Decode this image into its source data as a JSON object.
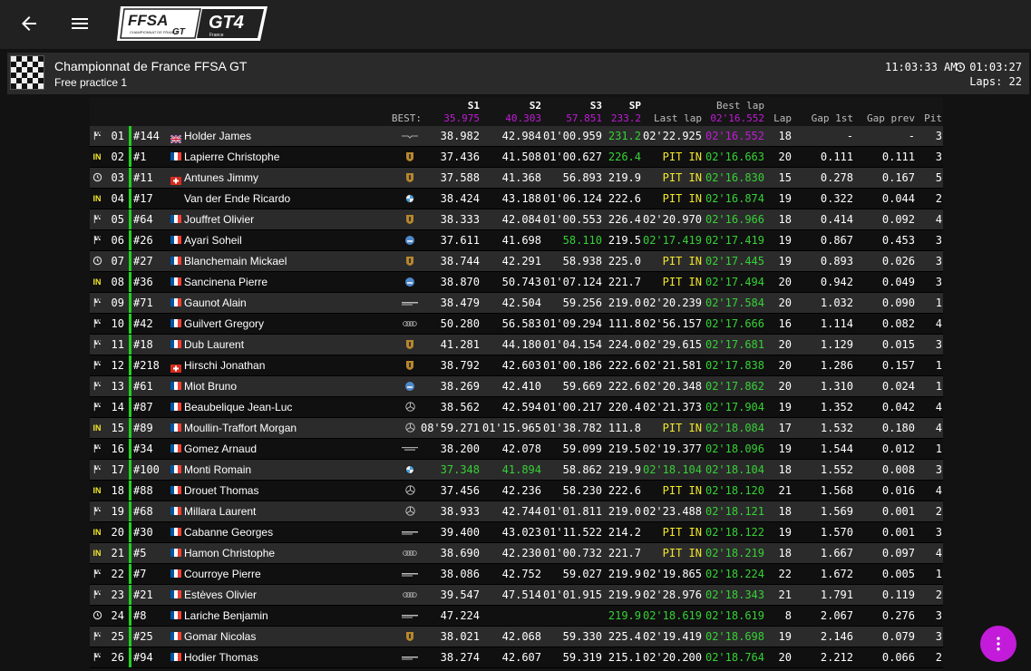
{
  "header": {
    "logo_ffsa": "FFSA",
    "logo_sub": "CHAMPIONNAT DE FRANCE",
    "logo_gt": "GT",
    "logo_gt4": "GT4",
    "logo_country": "France"
  },
  "session": {
    "championship": "Championnat de France FFSA GT",
    "name": "Free practice 1",
    "clock": "11:03:33 AM",
    "elapsed": "01:03:27",
    "laps": "Laps: 22"
  },
  "columns": {
    "best_label": "BEST:",
    "s1": "S1",
    "s1_best": "35.975",
    "s2": "S2",
    "s2_best": "40.303",
    "s3": "S3",
    "s3_best": "57.851",
    "sp": "SP",
    "sp_best": "233.2",
    "last_lap": "Last lap",
    "best_lap": "Best lap",
    "best_lap_best": "02'16.552",
    "lap": "Lap",
    "gap1": "Gap 1st",
    "gapp": "Gap prev",
    "pit": "Pit"
  },
  "colors": {
    "purple": "#c21bd9",
    "green": "#36d136",
    "yellow": "#f2e72a"
  },
  "rows": [
    {
      "status": "flag",
      "pos": "01",
      "num": "#144",
      "nat": "gb",
      "name": "Holder James",
      "brand": "aston",
      "s1": "38.982",
      "s2": "42.984",
      "s3": "01'00.959",
      "sp": "231.2",
      "sp_c": "g",
      "last": "02'22.925",
      "last_c": "",
      "best": "02'16.552",
      "best_c": "p",
      "lap": "18",
      "gap1": "-",
      "gapp": "-",
      "pit": "3"
    },
    {
      "status": "IN",
      "pos": "02",
      "num": "#1",
      "nat": "fr",
      "name": "Lapierre Christophe",
      "brand": "porsche",
      "s1": "37.436",
      "s2": "41.508",
      "s3": "01'00.627",
      "sp": "226.4",
      "sp_c": "g",
      "last": "PIT IN",
      "last_c": "y",
      "best": "02'16.663",
      "best_c": "g",
      "lap": "20",
      "gap1": "0.111",
      "gapp": "0.111",
      "pit": "3"
    },
    {
      "status": "clock",
      "pos": "03",
      "num": "#11",
      "nat": "ch",
      "name": "Antunes Jimmy",
      "brand": "porsche",
      "s1": "37.588",
      "s2": "41.368",
      "s3": "56.893",
      "sp": "219.9",
      "sp_c": "",
      "last": "PIT IN",
      "last_c": "y",
      "best": "02'16.830",
      "best_c": "g",
      "lap": "15",
      "gap1": "0.278",
      "gapp": "0.167",
      "pit": "5"
    },
    {
      "status": "IN",
      "pos": "04",
      "num": "#17",
      "nat": "",
      "name": "Van der Ende Ricardo",
      "brand": "bmw",
      "s1": "38.424",
      "s2": "43.188",
      "s3": "01'06.124",
      "sp": "222.6",
      "sp_c": "",
      "last": "PIT IN",
      "last_c": "y",
      "best": "02'16.874",
      "best_c": "g",
      "lap": "19",
      "gap1": "0.322",
      "gapp": "0.044",
      "pit": "2"
    },
    {
      "status": "flag",
      "pos": "05",
      "num": "#64",
      "nat": "fr",
      "name": "Jouffret Olivier",
      "brand": "porsche",
      "s1": "38.333",
      "s2": "42.084",
      "s3": "01'00.553",
      "sp": "226.4",
      "sp_c": "",
      "last": "02'20.970",
      "last_c": "",
      "best": "02'16.966",
      "best_c": "g",
      "lap": "18",
      "gap1": "0.414",
      "gapp": "0.092",
      "pit": "4"
    },
    {
      "status": "flag",
      "pos": "06",
      "num": "#26",
      "nat": "fr",
      "name": "Ayari Soheil",
      "brand": "alpine",
      "s1": "37.611",
      "s2": "41.698",
      "s3": "58.110",
      "s3_c": "g",
      "sp": "219.5",
      "sp_c": "",
      "last": "02'17.419",
      "last_c": "g",
      "best": "02'17.419",
      "best_c": "g",
      "lap": "19",
      "gap1": "0.867",
      "gapp": "0.453",
      "pit": "3"
    },
    {
      "status": "clock",
      "pos": "07",
      "num": "#27",
      "nat": "fr",
      "name": "Blanchemain Mickael",
      "brand": "porsche",
      "s1": "38.744",
      "s2": "42.291",
      "s3": "58.938",
      "sp": "225.0",
      "sp_c": "",
      "last": "PIT IN",
      "last_c": "y",
      "best": "02'17.445",
      "best_c": "g",
      "lap": "19",
      "gap1": "0.893",
      "gapp": "0.026",
      "pit": "3"
    },
    {
      "status": "IN",
      "pos": "08",
      "num": "#36",
      "nat": "fr",
      "name": "Sancinena Pierre",
      "brand": "alpine",
      "s1": "38.870",
      "s2": "50.743",
      "s3": "01'07.124",
      "sp": "221.7",
      "sp_c": "",
      "last": "PIT IN",
      "last_c": "y",
      "best": "02'17.494",
      "best_c": "g",
      "lap": "20",
      "gap1": "0.942",
      "gapp": "0.049",
      "pit": "3"
    },
    {
      "status": "flag",
      "pos": "09",
      "num": "#71",
      "nat": "fr",
      "name": "Gaunot Alain",
      "brand": "mclaren",
      "s1": "38.479",
      "s2": "42.504",
      "s3": "59.256",
      "sp": "219.0",
      "sp_c": "",
      "last": "02'20.239",
      "last_c": "",
      "best": "02'17.584",
      "best_c": "g",
      "lap": "20",
      "gap1": "1.032",
      "gapp": "0.090",
      "pit": "1"
    },
    {
      "status": "flag",
      "pos": "10",
      "num": "#42",
      "nat": "fr",
      "name": "Guilvert Gregory",
      "brand": "audi",
      "s1": "50.280",
      "s2": "56.583",
      "s3": "01'09.294",
      "sp": "111.8",
      "sp_c": "",
      "last": "02'56.157",
      "last_c": "",
      "best": "02'17.666",
      "best_c": "g",
      "lap": "16",
      "gap1": "1.114",
      "gapp": "0.082",
      "pit": "4"
    },
    {
      "status": "flag",
      "pos": "11",
      "num": "#18",
      "nat": "fr",
      "name": "Dub Laurent",
      "brand": "porsche",
      "s1": "41.281",
      "s2": "44.180",
      "s3": "01'04.154",
      "sp": "224.0",
      "sp_c": "",
      "last": "02'29.615",
      "last_c": "",
      "best": "02'17.681",
      "best_c": "g",
      "lap": "20",
      "gap1": "1.129",
      "gapp": "0.015",
      "pit": "3"
    },
    {
      "status": "flag",
      "pos": "12",
      "num": "#218",
      "nat": "ch",
      "name": "Hirschi Jonathan",
      "brand": "porsche",
      "s1": "38.792",
      "s2": "42.603",
      "s3": "01'00.186",
      "sp": "222.6",
      "sp_c": "",
      "last": "02'21.581",
      "last_c": "",
      "best": "02'17.838",
      "best_c": "g",
      "lap": "20",
      "gap1": "1.286",
      "gapp": "0.157",
      "pit": "1"
    },
    {
      "status": "flag",
      "pos": "13",
      "num": "#61",
      "nat": "fr",
      "name": "Miot Bruno",
      "brand": "alpine",
      "s1": "38.269",
      "s2": "42.410",
      "s3": "59.669",
      "sp": "222.6",
      "sp_c": "",
      "last": "02'20.348",
      "last_c": "",
      "best": "02'17.862",
      "best_c": "g",
      "lap": "20",
      "gap1": "1.310",
      "gapp": "0.024",
      "pit": "1"
    },
    {
      "status": "flag",
      "pos": "14",
      "num": "#87",
      "nat": "fr",
      "name": "Beaubelique Jean-Luc",
      "brand": "mercedes",
      "s1": "38.562",
      "s2": "42.594",
      "s3": "01'00.217",
      "sp": "220.4",
      "sp_c": "",
      "last": "02'21.373",
      "last_c": "",
      "best": "02'17.904",
      "best_c": "g",
      "lap": "19",
      "gap1": "1.352",
      "gapp": "0.042",
      "pit": "4"
    },
    {
      "status": "IN",
      "pos": "15",
      "num": "#89",
      "nat": "fr",
      "name": "Moullin-Traffort Morgan",
      "brand": "mercedes",
      "s1": "08'59.271",
      "s2": "01'15.965",
      "s3": "01'38.782",
      "sp": "111.8",
      "sp_c": "",
      "last": "PIT IN",
      "last_c": "y",
      "best": "02'18.084",
      "best_c": "g",
      "lap": "17",
      "gap1": "1.532",
      "gapp": "0.180",
      "pit": "4"
    },
    {
      "status": "flag",
      "pos": "16",
      "num": "#34",
      "nat": "fr",
      "name": "Gomez Arnaud",
      "brand": "maserati",
      "s1": "38.200",
      "s2": "42.078",
      "s3": "59.099",
      "sp": "219.5",
      "sp_c": "",
      "last": "02'19.377",
      "last_c": "",
      "best": "02'18.096",
      "best_c": "g",
      "lap": "19",
      "gap1": "1.544",
      "gapp": "0.012",
      "pit": "1"
    },
    {
      "status": "flag",
      "pos": "17",
      "num": "#100",
      "nat": "fr",
      "name": "Monti Romain",
      "brand": "bmw",
      "s1": "37.348",
      "s1_c": "g",
      "s2": "41.894",
      "s2_c": "g",
      "s3": "58.862",
      "sp": "219.9",
      "sp_c": "",
      "last": "02'18.104",
      "last_c": "g",
      "best": "02'18.104",
      "best_c": "g",
      "lap": "18",
      "gap1": "1.552",
      "gapp": "0.008",
      "pit": "3"
    },
    {
      "status": "IN",
      "pos": "18",
      "num": "#88",
      "nat": "fr",
      "name": "Drouet Thomas",
      "brand": "mercedes",
      "s1": "37.456",
      "s2": "42.236",
      "s3": "58.230",
      "sp": "222.6",
      "sp_c": "",
      "last": "PIT IN",
      "last_c": "y",
      "best": "02'18.120",
      "best_c": "g",
      "lap": "21",
      "gap1": "1.568",
      "gapp": "0.016",
      "pit": "4"
    },
    {
      "status": "flag",
      "pos": "19",
      "num": "#68",
      "nat": "fr",
      "name": "Millara Laurent",
      "brand": "mercedes",
      "s1": "38.933",
      "s2": "42.744",
      "s3": "01'01.811",
      "sp": "219.0",
      "sp_c": "",
      "last": "02'23.488",
      "last_c": "",
      "best": "02'18.121",
      "best_c": "g",
      "lap": "18",
      "gap1": "1.569",
      "gapp": "0.001",
      "pit": "2"
    },
    {
      "status": "IN",
      "pos": "20",
      "num": "#30",
      "nat": "fr",
      "name": "Cabanne Georges",
      "brand": "mclaren",
      "s1": "39.400",
      "s2": "43.023",
      "s3": "01'11.522",
      "sp": "214.2",
      "sp_c": "",
      "last": "PIT IN",
      "last_c": "y",
      "best": "02'18.122",
      "best_c": "g",
      "lap": "19",
      "gap1": "1.570",
      "gapp": "0.001",
      "pit": "3"
    },
    {
      "status": "IN",
      "pos": "21",
      "num": "#5",
      "nat": "fr",
      "name": "Hamon Christophe",
      "brand": "audi",
      "s1": "38.690",
      "s2": "42.230",
      "s3": "01'00.732",
      "sp": "221.7",
      "sp_c": "",
      "last": "PIT IN",
      "last_c": "y",
      "best": "02'18.219",
      "best_c": "g",
      "lap": "18",
      "gap1": "1.667",
      "gapp": "0.097",
      "pit": "4"
    },
    {
      "status": "flag",
      "pos": "22",
      "num": "#7",
      "nat": "fr",
      "name": "Courroye Pierre",
      "brand": "mclaren",
      "s1": "38.086",
      "s2": "42.752",
      "s3": "59.027",
      "sp": "219.9",
      "sp_c": "",
      "last": "02'19.865",
      "last_c": "",
      "best": "02'18.224",
      "best_c": "g",
      "lap": "22",
      "gap1": "1.672",
      "gapp": "0.005",
      "pit": "1"
    },
    {
      "status": "flag",
      "pos": "23",
      "num": "#21",
      "nat": "fr",
      "name": "Estèves Olivier",
      "brand": "audi",
      "s1": "39.547",
      "s2": "47.514",
      "s3": "01'01.915",
      "sp": "219.9",
      "sp_c": "",
      "last": "02'28.976",
      "last_c": "",
      "best": "02'18.343",
      "best_c": "g",
      "lap": "21",
      "gap1": "1.791",
      "gapp": "0.119",
      "pit": "2"
    },
    {
      "status": "clock",
      "pos": "24",
      "num": "#8",
      "nat": "fr",
      "name": "Lariche Benjamin",
      "brand": "mclaren",
      "s1": "47.224",
      "s2": "",
      "s3": "",
      "sp": "219.9",
      "sp_c": "g",
      "last": "02'18.619",
      "last_c": "g",
      "best": "02'18.619",
      "best_c": "g",
      "lap": "8",
      "gap1": "2.067",
      "gapp": "0.276",
      "pit": "3"
    },
    {
      "status": "flag",
      "pos": "25",
      "num": "#25",
      "nat": "fr",
      "name": "Gomar Nicolas",
      "brand": "porsche",
      "s1": "38.021",
      "s2": "42.068",
      "s3": "59.330",
      "sp": "225.4",
      "sp_c": "",
      "last": "02'19.419",
      "last_c": "",
      "best": "02'18.698",
      "best_c": "g",
      "lap": "19",
      "gap1": "2.146",
      "gapp": "0.079",
      "pit": "3"
    },
    {
      "status": "flag",
      "pos": "26",
      "num": "#94",
      "nat": "fr",
      "name": "Hodier Thomas",
      "brand": "mclaren",
      "s1": "38.274",
      "s2": "42.607",
      "s3": "59.319",
      "sp": "215.1",
      "sp_c": "",
      "last": "02'20.200",
      "last_c": "",
      "best": "02'18.764",
      "best_c": "g",
      "lap": "20",
      "gap1": "2.212",
      "gapp": "0.066",
      "pit": "2"
    }
  ]
}
